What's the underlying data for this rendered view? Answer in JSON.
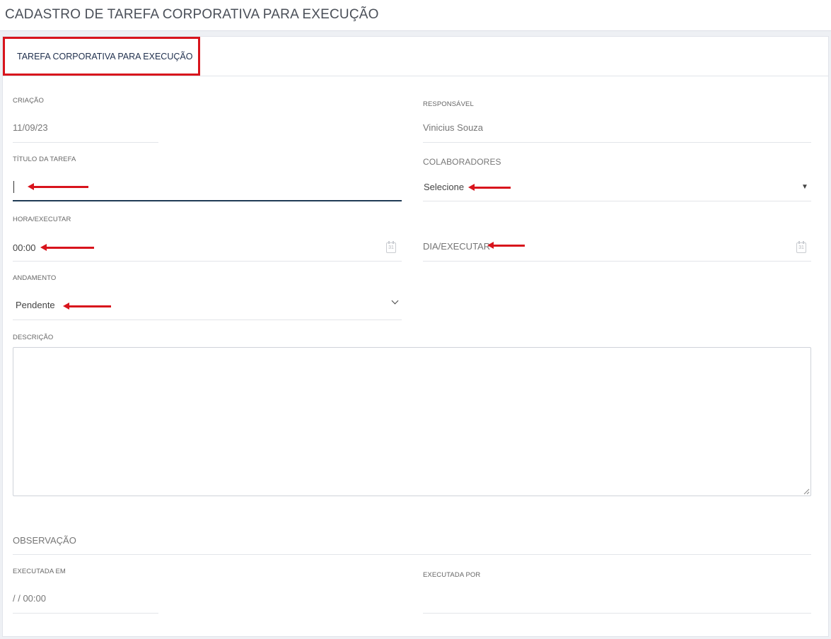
{
  "page": {
    "title": "CADASTRO DE TAREFA CORPORATIVA PARA EXECUÇÃO"
  },
  "tabs": [
    {
      "label": "TAREFA CORPORATIVA PARA EXECUÇÃO",
      "active": true
    }
  ],
  "form": {
    "criacao": {
      "label": "CRIAÇÃO",
      "value": "11/09/23"
    },
    "responsavel": {
      "label": "RESPONSÁVEL",
      "value": "Vinicius Souza"
    },
    "titulo": {
      "label": "TÍTULO DA TAREFA",
      "value": ""
    },
    "colaboradores": {
      "label": "COLABORADORES",
      "selected": "Selecione"
    },
    "hora_executar": {
      "label": "HORA/EXECUTAR",
      "value": "00:00"
    },
    "dia_executar": {
      "placeholder": "DIA/EXECUTAR"
    },
    "andamento": {
      "label": "ANDAMENTO",
      "selected": "Pendente"
    },
    "descricao": {
      "label": "DESCRIÇÃO",
      "value": ""
    },
    "observacao": {
      "placeholder": "OBSERVAÇÃO"
    },
    "executada_em": {
      "label": "EXECUTADA EM",
      "value": "/ / 00:00"
    },
    "executada_por": {
      "label": "EXECUTADA POR",
      "value": ""
    }
  },
  "icons": {
    "calendar": "calendar-icon",
    "caret": "caret-down-icon",
    "chevron": "chevron-down-icon",
    "arrow": "red-arrow-annotation"
  },
  "colors": {
    "accent_red": "#d8141c",
    "focus_underline": "#1f3a55",
    "tab_text": "#1f2f4d"
  }
}
